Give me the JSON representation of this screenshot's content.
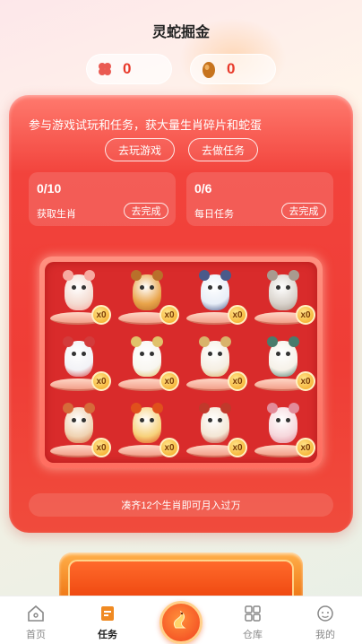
{
  "header": {
    "title": "灵蛇掘金"
  },
  "counters": [
    {
      "icon": "clover-icon",
      "value": "0",
      "color": "#e8504a"
    },
    {
      "icon": "snake-egg-icon",
      "value": "0",
      "color": "#c0701a"
    }
  ],
  "panel": {
    "intro": "参与游戏试玩和任务，获大量生肖碎片和蛇蛋",
    "play_button": "去玩游戏",
    "task_button": "去做任务",
    "task_cards": [
      {
        "count": "0/10",
        "label": "获取生肖",
        "action": "去完成"
      },
      {
        "count": "0/6",
        "label": "每日任务",
        "action": "去完成"
      }
    ],
    "zodiacs": [
      {
        "animal": "rat",
        "count": "x0",
        "color": "#f4dcd2",
        "accent": "#f7a9a0"
      },
      {
        "animal": "ox",
        "count": "x0",
        "color": "#e9a44a",
        "accent": "#b9702a"
      },
      {
        "animal": "tiger",
        "count": "x0",
        "color": "#e8eef7",
        "accent": "#4a5a8a"
      },
      {
        "animal": "rabbit",
        "count": "x0",
        "color": "#d9d3cc",
        "accent": "#a99a8f"
      },
      {
        "animal": "dragon",
        "count": "x0",
        "color": "#f2f2f6",
        "accent": "#d33b3b"
      },
      {
        "animal": "snake",
        "count": "x0",
        "color": "#f8f6f0",
        "accent": "#e1c26a"
      },
      {
        "animal": "horse",
        "count": "x0",
        "color": "#f5eee2",
        "accent": "#d9b36a"
      },
      {
        "animal": "goat",
        "count": "x0",
        "color": "#f6f1e8",
        "accent": "#4a7b6c"
      },
      {
        "animal": "monkey",
        "count": "x0",
        "color": "#f0d3b2",
        "accent": "#d66a3a"
      },
      {
        "animal": "rooster",
        "count": "x0",
        "color": "#f7d17a",
        "accent": "#e0501c"
      },
      {
        "animal": "dog",
        "count": "x0",
        "color": "#f3e6d4",
        "accent": "#c0392b"
      },
      {
        "animal": "pig",
        "count": "x0",
        "color": "#f6d7dc",
        "accent": "#e38b99"
      }
    ],
    "footer": "凑齐12个生肖即可月入过万"
  },
  "tabbar": {
    "tabs": [
      {
        "label": "首页",
        "icon": "home-icon",
        "active": false
      },
      {
        "label": "任务",
        "icon": "task-icon",
        "active": true
      },
      {
        "label": "仓库",
        "icon": "grid-icon",
        "active": false
      },
      {
        "label": "我的",
        "icon": "profile-icon",
        "active": false
      }
    ],
    "center_icon": "snake-center-icon"
  }
}
